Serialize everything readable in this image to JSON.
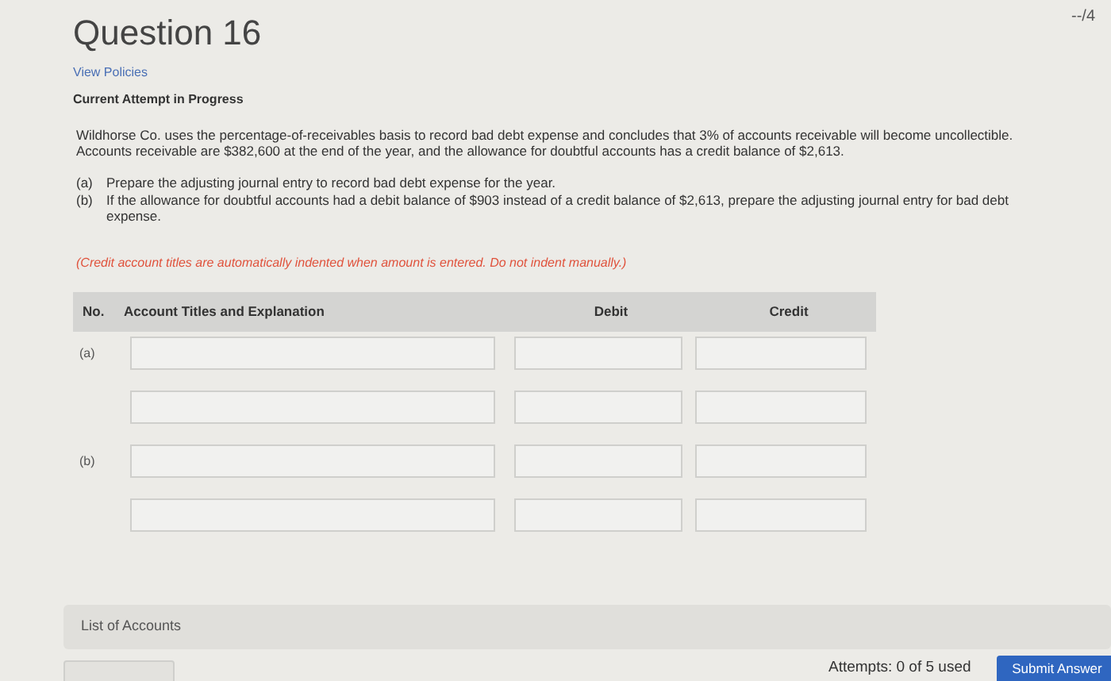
{
  "score": "--/4",
  "title": "Question 16",
  "policies_link": "View Policies",
  "attempt_status": "Current Attempt in Progress",
  "problem": "Wildhorse Co. uses the percentage-of-receivables basis to record bad debt expense and concludes that 3% of accounts receivable will become uncollectible. Accounts receivable are $382,600 at the end of the year, and the allowance for doubtful accounts has a credit balance of $2,613.",
  "parts": [
    {
      "label": "(a)",
      "text": "Prepare the adjusting journal entry to record bad debt expense for the year."
    },
    {
      "label": "(b)",
      "text": "If the allowance for doubtful accounts had a debit balance of $903 instead of a credit balance of $2,613, prepare the adjusting journal entry for bad debt expense."
    }
  ],
  "note": "(Credit account titles are automatically indented when amount is entered. Do not indent manually.)",
  "table": {
    "columns": [
      "No.",
      "Account Titles and Explanation",
      "Debit",
      "Credit"
    ],
    "rows": [
      {
        "no": "(a)"
      },
      {},
      {
        "no": "(b)"
      },
      {}
    ]
  },
  "list_of_accounts": "List of Accounts",
  "attempts": "Attempts: 0 of 5 used",
  "submit": "Submit Answer"
}
